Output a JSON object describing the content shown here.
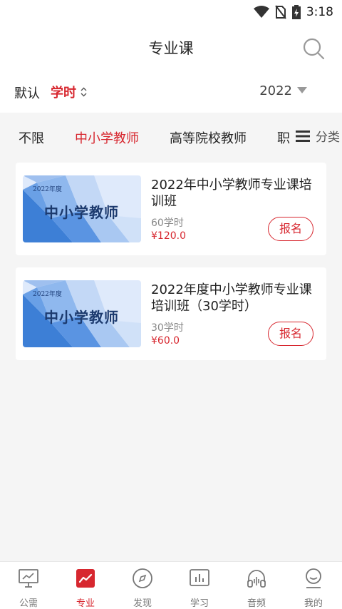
{
  "status_bar": {
    "time": "3:18"
  },
  "header": {
    "title": "专业课"
  },
  "sort": {
    "default_label": "默认",
    "hours_label": "学时",
    "year": "2022"
  },
  "categories": [
    "不限",
    "中小学教师",
    "高等院校教师",
    "职"
  ],
  "categories_more_label": "分类",
  "courses": [
    {
      "thumb_year": "2022年度",
      "thumb_title": "中小学教师",
      "title": "2022年中小学教师专业课培训班",
      "hours": "60学时",
      "price": "¥120.0",
      "button": "报名"
    },
    {
      "thumb_year": "2022年度",
      "thumb_title": "中小学教师",
      "title": "2022年度中小学教师专业课培训班（30学时）",
      "hours": "30学时",
      "price": "¥60.0",
      "button": "报名"
    }
  ],
  "tabs": [
    {
      "label": "公需",
      "icon": "monitor-icon"
    },
    {
      "label": "专业",
      "icon": "trend-icon"
    },
    {
      "label": "发现",
      "icon": "compass-icon"
    },
    {
      "label": "学习",
      "icon": "chart-icon"
    },
    {
      "label": "音频",
      "icon": "headphones-icon"
    },
    {
      "label": "我的",
      "icon": "user-icon"
    }
  ],
  "colors": {
    "accent": "#d7272f",
    "thumb_blue": "#3d7fd6"
  }
}
